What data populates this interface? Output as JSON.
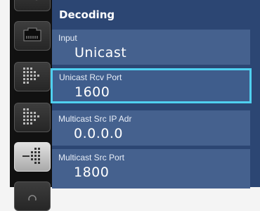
{
  "panel": {
    "title": "Decoding",
    "fields": [
      {
        "label": "Input",
        "value": "Unicast"
      },
      {
        "label": "Unicast Rcv Port",
        "value": "1600"
      },
      {
        "label": "Multicast Src IP Adr",
        "value": "0.0.0.0"
      },
      {
        "label": "Multicast Src Port",
        "value": "1800"
      }
    ]
  },
  "sidebar": {
    "items": [
      {
        "icon": "key-icon"
      },
      {
        "icon": "ethernet-port-icon"
      },
      {
        "icon": "decode-grid-icon"
      },
      {
        "icon": "encode-grid-icon"
      },
      {
        "icon": "decode-arrow-icon"
      },
      {
        "icon": "settings-icon"
      }
    ]
  },
  "colors": {
    "panel_bg": "#2c4673",
    "field_bg": "#45618e",
    "selected_border": "#4fd0f0"
  }
}
